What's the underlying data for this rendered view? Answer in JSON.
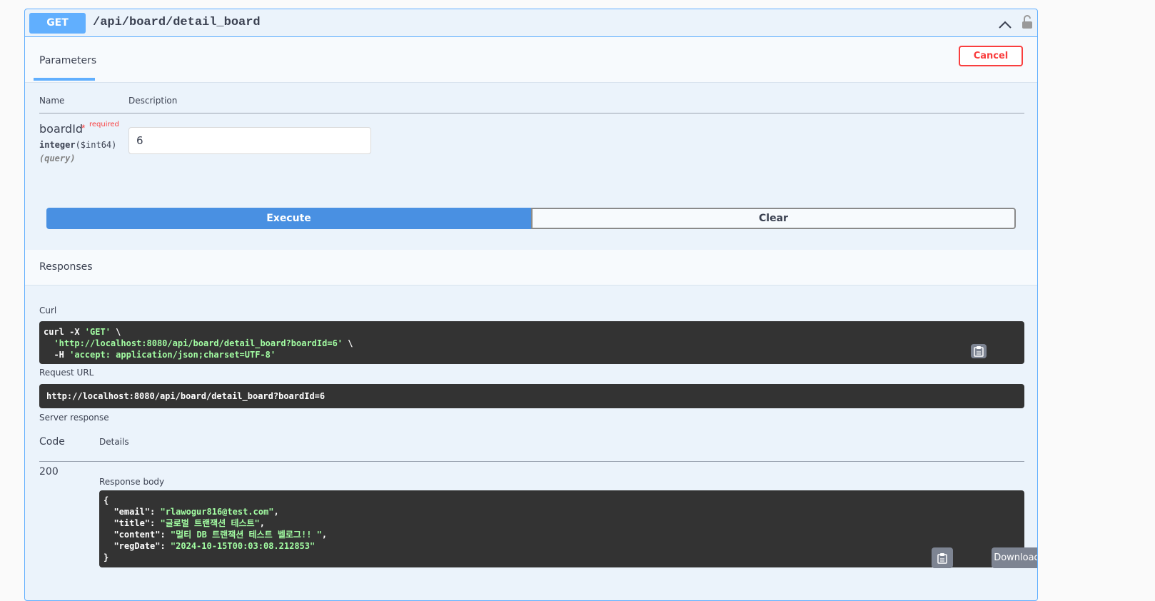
{
  "operation": {
    "method": "GET",
    "path": "/api/board/detail_board"
  },
  "tabs": {
    "parameters": "Parameters",
    "cancel": "Cancel"
  },
  "parameters": {
    "col_name": "Name",
    "col_description": "Description",
    "items": [
      {
        "name": "boardId",
        "required_star": "*",
        "required_label": "required",
        "type": "integer",
        "format": "($int64)",
        "in": "(query)",
        "value": "6"
      }
    ]
  },
  "actions": {
    "execute": "Execute",
    "clear": "Clear"
  },
  "responses": {
    "title": "Responses",
    "curl_label": "Curl",
    "curl": {
      "line1_cmd": "curl -X ",
      "line1_method": "'GET'",
      "line1_end": " \\",
      "line2_url": "'http://localhost:8080/api/board/detail_board?boardId=6'",
      "line2_end": " \\",
      "line3_flag": "  -H ",
      "line3_header": "'accept: application/json;charset=UTF-8'"
    },
    "request_url_label": "Request URL",
    "request_url": "http://localhost:8080/api/board/detail_board?boardId=6",
    "server_response_label": "Server response",
    "col_code": "Code",
    "col_details": "Details",
    "code": "200",
    "response_body_label": "Response body",
    "body": {
      "open": "{",
      "email_key": "  \"email\": ",
      "email_val": "\"rlawogur816@test.com\"",
      "title_key": "  \"title\": ",
      "title_val": "\"글로벌 트랜잭션 테스트\"",
      "content_key": "  \"content\": ",
      "content_val": "\"멀티 DB 트랜잭션 테스트 벨로그!! \"",
      "regdate_key": "  \"regDate\": ",
      "regdate_val": "\"2024-10-15T00:03:08.212853\"",
      "close": "}"
    },
    "download": "Download"
  },
  "colors": {
    "get_accent": "#61affe",
    "execute_blue": "#4990e2",
    "cancel_red": "#f93e3e",
    "code_bg": "#333333",
    "string_green": "#a2fca2"
  },
  "icons": [
    "chevron-up-icon",
    "unlock-icon",
    "copy-icon"
  ]
}
